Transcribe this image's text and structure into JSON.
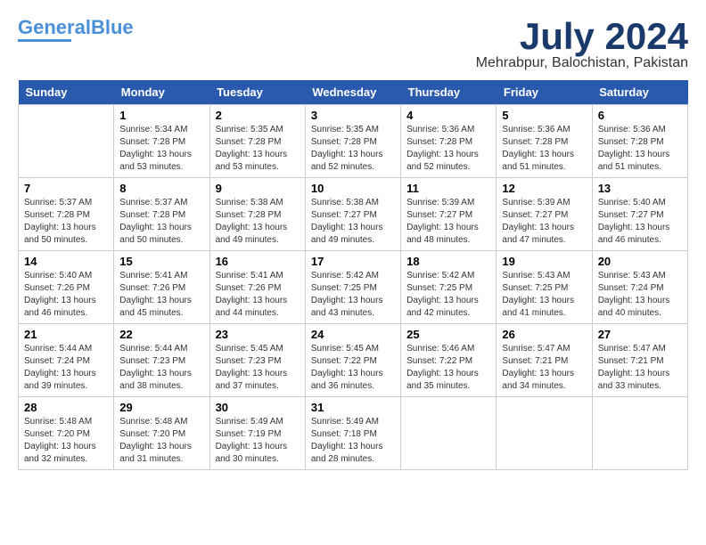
{
  "logo": {
    "part1": "General",
    "part2": "Blue"
  },
  "title": {
    "month": "July 2024",
    "location": "Mehrabpur, Balochistan, Pakistan"
  },
  "headers": [
    "Sunday",
    "Monday",
    "Tuesday",
    "Wednesday",
    "Thursday",
    "Friday",
    "Saturday"
  ],
  "weeks": [
    [
      {
        "day": "",
        "sunrise": "",
        "sunset": "",
        "daylight": ""
      },
      {
        "day": "1",
        "sunrise": "Sunrise: 5:34 AM",
        "sunset": "Sunset: 7:28 PM",
        "daylight": "Daylight: 13 hours and 53 minutes."
      },
      {
        "day": "2",
        "sunrise": "Sunrise: 5:35 AM",
        "sunset": "Sunset: 7:28 PM",
        "daylight": "Daylight: 13 hours and 53 minutes."
      },
      {
        "day": "3",
        "sunrise": "Sunrise: 5:35 AM",
        "sunset": "Sunset: 7:28 PM",
        "daylight": "Daylight: 13 hours and 52 minutes."
      },
      {
        "day": "4",
        "sunrise": "Sunrise: 5:36 AM",
        "sunset": "Sunset: 7:28 PM",
        "daylight": "Daylight: 13 hours and 52 minutes."
      },
      {
        "day": "5",
        "sunrise": "Sunrise: 5:36 AM",
        "sunset": "Sunset: 7:28 PM",
        "daylight": "Daylight: 13 hours and 51 minutes."
      },
      {
        "day": "6",
        "sunrise": "Sunrise: 5:36 AM",
        "sunset": "Sunset: 7:28 PM",
        "daylight": "Daylight: 13 hours and 51 minutes."
      }
    ],
    [
      {
        "day": "7",
        "sunrise": "Sunrise: 5:37 AM",
        "sunset": "Sunset: 7:28 PM",
        "daylight": "Daylight: 13 hours and 50 minutes."
      },
      {
        "day": "8",
        "sunrise": "Sunrise: 5:37 AM",
        "sunset": "Sunset: 7:28 PM",
        "daylight": "Daylight: 13 hours and 50 minutes."
      },
      {
        "day": "9",
        "sunrise": "Sunrise: 5:38 AM",
        "sunset": "Sunset: 7:28 PM",
        "daylight": "Daylight: 13 hours and 49 minutes."
      },
      {
        "day": "10",
        "sunrise": "Sunrise: 5:38 AM",
        "sunset": "Sunset: 7:27 PM",
        "daylight": "Daylight: 13 hours and 49 minutes."
      },
      {
        "day": "11",
        "sunrise": "Sunrise: 5:39 AM",
        "sunset": "Sunset: 7:27 PM",
        "daylight": "Daylight: 13 hours and 48 minutes."
      },
      {
        "day": "12",
        "sunrise": "Sunrise: 5:39 AM",
        "sunset": "Sunset: 7:27 PM",
        "daylight": "Daylight: 13 hours and 47 minutes."
      },
      {
        "day": "13",
        "sunrise": "Sunrise: 5:40 AM",
        "sunset": "Sunset: 7:27 PM",
        "daylight": "Daylight: 13 hours and 46 minutes."
      }
    ],
    [
      {
        "day": "14",
        "sunrise": "Sunrise: 5:40 AM",
        "sunset": "Sunset: 7:26 PM",
        "daylight": "Daylight: 13 hours and 46 minutes."
      },
      {
        "day": "15",
        "sunrise": "Sunrise: 5:41 AM",
        "sunset": "Sunset: 7:26 PM",
        "daylight": "Daylight: 13 hours and 45 minutes."
      },
      {
        "day": "16",
        "sunrise": "Sunrise: 5:41 AM",
        "sunset": "Sunset: 7:26 PM",
        "daylight": "Daylight: 13 hours and 44 minutes."
      },
      {
        "day": "17",
        "sunrise": "Sunrise: 5:42 AM",
        "sunset": "Sunset: 7:25 PM",
        "daylight": "Daylight: 13 hours and 43 minutes."
      },
      {
        "day": "18",
        "sunrise": "Sunrise: 5:42 AM",
        "sunset": "Sunset: 7:25 PM",
        "daylight": "Daylight: 13 hours and 42 minutes."
      },
      {
        "day": "19",
        "sunrise": "Sunrise: 5:43 AM",
        "sunset": "Sunset: 7:25 PM",
        "daylight": "Daylight: 13 hours and 41 minutes."
      },
      {
        "day": "20",
        "sunrise": "Sunrise: 5:43 AM",
        "sunset": "Sunset: 7:24 PM",
        "daylight": "Daylight: 13 hours and 40 minutes."
      }
    ],
    [
      {
        "day": "21",
        "sunrise": "Sunrise: 5:44 AM",
        "sunset": "Sunset: 7:24 PM",
        "daylight": "Daylight: 13 hours and 39 minutes."
      },
      {
        "day": "22",
        "sunrise": "Sunrise: 5:44 AM",
        "sunset": "Sunset: 7:23 PM",
        "daylight": "Daylight: 13 hours and 38 minutes."
      },
      {
        "day": "23",
        "sunrise": "Sunrise: 5:45 AM",
        "sunset": "Sunset: 7:23 PM",
        "daylight": "Daylight: 13 hours and 37 minutes."
      },
      {
        "day": "24",
        "sunrise": "Sunrise: 5:45 AM",
        "sunset": "Sunset: 7:22 PM",
        "daylight": "Daylight: 13 hours and 36 minutes."
      },
      {
        "day": "25",
        "sunrise": "Sunrise: 5:46 AM",
        "sunset": "Sunset: 7:22 PM",
        "daylight": "Daylight: 13 hours and 35 minutes."
      },
      {
        "day": "26",
        "sunrise": "Sunrise: 5:47 AM",
        "sunset": "Sunset: 7:21 PM",
        "daylight": "Daylight: 13 hours and 34 minutes."
      },
      {
        "day": "27",
        "sunrise": "Sunrise: 5:47 AM",
        "sunset": "Sunset: 7:21 PM",
        "daylight": "Daylight: 13 hours and 33 minutes."
      }
    ],
    [
      {
        "day": "28",
        "sunrise": "Sunrise: 5:48 AM",
        "sunset": "Sunset: 7:20 PM",
        "daylight": "Daylight: 13 hours and 32 minutes."
      },
      {
        "day": "29",
        "sunrise": "Sunrise: 5:48 AM",
        "sunset": "Sunset: 7:20 PM",
        "daylight": "Daylight: 13 hours and 31 minutes."
      },
      {
        "day": "30",
        "sunrise": "Sunrise: 5:49 AM",
        "sunset": "Sunset: 7:19 PM",
        "daylight": "Daylight: 13 hours and 30 minutes."
      },
      {
        "day": "31",
        "sunrise": "Sunrise: 5:49 AM",
        "sunset": "Sunset: 7:18 PM",
        "daylight": "Daylight: 13 hours and 28 minutes."
      },
      {
        "day": "",
        "sunrise": "",
        "sunset": "",
        "daylight": ""
      },
      {
        "day": "",
        "sunrise": "",
        "sunset": "",
        "daylight": ""
      },
      {
        "day": "",
        "sunrise": "",
        "sunset": "",
        "daylight": ""
      }
    ]
  ]
}
